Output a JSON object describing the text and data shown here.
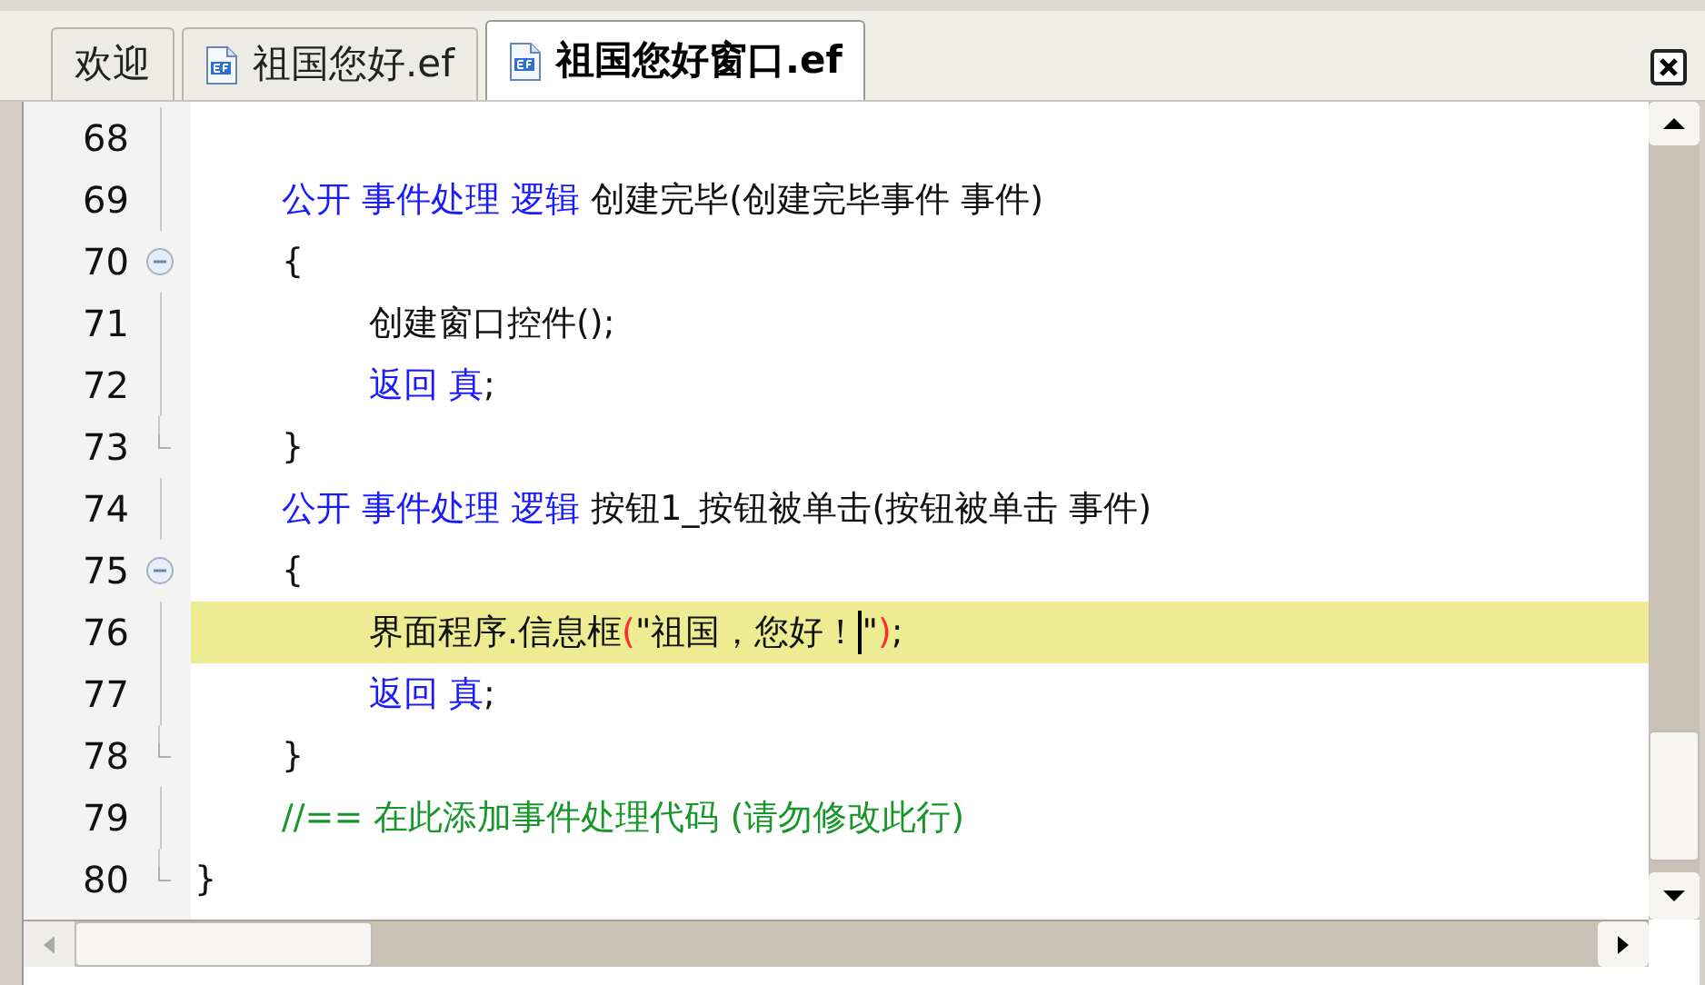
{
  "tabs": [
    {
      "label": "欢迎",
      "icon": false,
      "selected": false
    },
    {
      "label": "祖国您好.ef",
      "icon": true,
      "selected": false
    },
    {
      "label": "祖国您好窗口.ef",
      "icon": true,
      "selected": true
    }
  ],
  "lines": [
    {
      "number": "68",
      "kind": "plain"
    },
    {
      "number": "69",
      "kind": "plain",
      "tokens": [
        {
          "kind": "keyword",
          "text": "\t公开 事件处理 逻辑"
        },
        {
          "kind": "text",
          "text": " 创建完毕(创建完毕事件 事件)"
        }
      ]
    },
    {
      "number": "70",
      "kind": "fold_start",
      "tokens": [
        {
          "kind": "text",
          "text": "\t{"
        }
      ]
    },
    {
      "number": "71",
      "kind": "plain",
      "tokens": [
        {
          "kind": "text",
          "text": "\t\t创建窗口控件();"
        }
      ]
    },
    {
      "number": "72",
      "kind": "plain",
      "tokens": [
        {
          "kind": "keyword",
          "text": "\t\t返回 真"
        },
        {
          "kind": "text",
          "text": ";"
        }
      ]
    },
    {
      "number": "73",
      "kind": "fold_end",
      "tokens": [
        {
          "kind": "text",
          "text": "\t}"
        }
      ]
    },
    {
      "number": "74",
      "kind": "plain",
      "tokens": [
        {
          "kind": "keyword",
          "text": "\t公开 事件处理 逻辑"
        },
        {
          "kind": "text",
          "text": " 按钮1_按钮被单击(按钮被单击 事件)"
        }
      ]
    },
    {
      "number": "75",
      "kind": "fold_start",
      "tokens": [
        {
          "kind": "text",
          "text": "\t{"
        }
      ]
    },
    {
      "number": "76",
      "kind": "plain",
      "current": true,
      "tokens": [
        {
          "kind": "text",
          "text": "\t\t界面程序.信息框"
        },
        {
          "kind": "brace",
          "text": "("
        },
        {
          "kind": "text",
          "text": "\"祖国，您好！"
        },
        {
          "kind": "cursor"
        },
        {
          "kind": "text",
          "text": "\""
        },
        {
          "kind": "brace",
          "text": ")"
        },
        {
          "kind": "text",
          "text": ";"
        }
      ]
    },
    {
      "number": "77",
      "kind": "plain",
      "tokens": [
        {
          "kind": "keyword",
          "text": "\t\t返回 真"
        },
        {
          "kind": "text",
          "text": ";"
        }
      ]
    },
    {
      "number": "78",
      "kind": "fold_end",
      "tokens": [
        {
          "kind": "text",
          "text": "\t}"
        }
      ]
    },
    {
      "number": "79",
      "kind": "plain",
      "tokens": [
        {
          "kind": "comment",
          "text": "\t//== 在此添加事件处理代码 (请勿修改此行)"
        }
      ]
    },
    {
      "number": "80",
      "kind": "fold_end",
      "tokens": [
        {
          "kind": "text",
          "text": "}"
        }
      ]
    }
  ]
}
